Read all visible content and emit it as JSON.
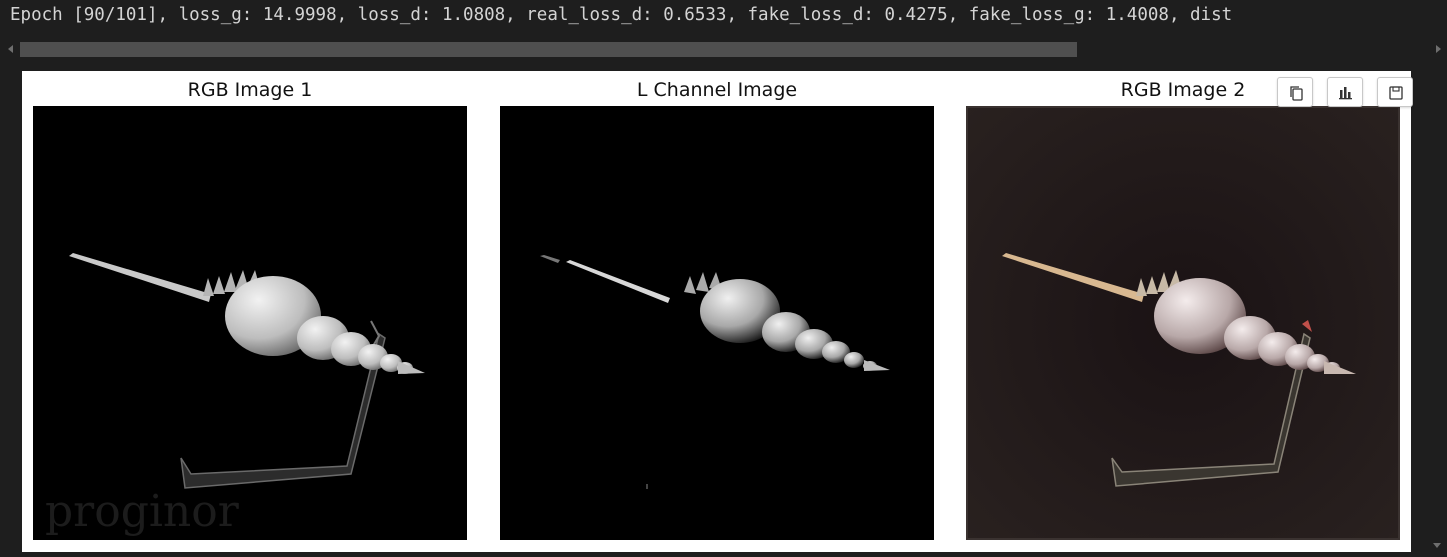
{
  "log": {
    "line": "Epoch [90/101], loss_g: 14.9998, loss_d: 1.0808, real_loss_d: 0.6533, fake_loss_d: 0.4275, fake_loss_g: 1.4008, dist"
  },
  "figure": {
    "panels": [
      {
        "title": "RGB Image 1"
      },
      {
        "title": "L Channel Image"
      },
      {
        "title": "RGB Image 2"
      }
    ],
    "toolbar": {
      "icons": [
        "copy-icon",
        "chart-icon",
        "save-icon"
      ]
    },
    "watermark": "proginor"
  },
  "colors": {
    "background": "#1e1e1e",
    "text": "#d4d4d4",
    "scrollbar_thumb": "#4f4f4f",
    "figure_bg": "#ffffff"
  }
}
